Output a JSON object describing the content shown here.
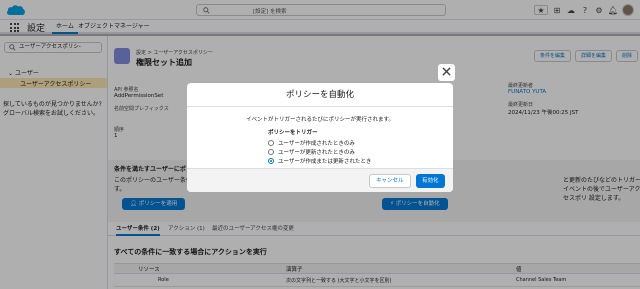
{
  "header": {
    "search_placeholder": "[設定] を検索",
    "icons": [
      "favorites-star-icon",
      "add-icon",
      "trailhead-icon",
      "help-icon",
      "setup-gear-icon",
      "notifications-bell-icon",
      "avatar"
    ]
  },
  "app_nav": {
    "app_name": "設定",
    "tabs": [
      "ホーム",
      "オブジェクトマネージャー"
    ]
  },
  "sidebar": {
    "quick_find_value": "ユーザーアクセスポリシ-",
    "section": "ユーザー",
    "active_item": "ユーザーアクセスポリシー",
    "help_text": "探しているものが見つかりませんか? グローバル検索をお試しください。"
  },
  "page": {
    "breadcrumb": "設定 > ユーザーアクセスポリシー",
    "title": "権限セット追加",
    "buttons": [
      "条件を編集",
      "詳細を編集",
      "削除"
    ],
    "details_left": [
      {
        "label": "API 参照名",
        "value": "AddPermissionSet"
      },
      {
        "label": "名前空間プレフィックス",
        "value": ""
      },
      {
        "label": "順序",
        "value": "1"
      }
    ],
    "details_right": [
      {
        "label": "最終更新者",
        "value": "FUNATO YUTA"
      },
      {
        "label": "最終更新日",
        "value": "2024/11/23 午後00:25 JST"
      }
    ],
    "conditions": {
      "title": "条件を満たすユーザーにポリシ",
      "text_left": "このポリシーのユーザー条件 リシーを手動で適用します。",
      "text_right": "と更新のたびなどのトリガーイベントの後でユーザーアクセスポリ 設定します。",
      "apply_button": "ポリシーを適用",
      "auto_button": "ポリシーを自動化"
    },
    "tabs": [
      "ユーザー条件 (2)",
      "アクション (1)",
      "最近のユーザーアクセス権の変更"
    ],
    "section_title": "すべての条件に一致する場合にアクションを実行",
    "table": {
      "headers": [
        "リソース",
        "演算子",
        "値"
      ],
      "rows": [
        [
          "Role",
          "次の文字列と一致する (大文字と小文字を区別)",
          "Channel Sales Team"
        ]
      ]
    }
  },
  "modal": {
    "title": "ポリシーを自動化",
    "description": "イベントがトリガーされるたびにポリシーが実行されます。",
    "trigger_label": "ポリシーをトリガー",
    "options": [
      "ユーザーが作成されたときのみ",
      "ユーザーが更新されたときのみ",
      "ユーザーが作成または更新されたとき"
    ],
    "selected_option": 2,
    "cancel_label": "キャンセル",
    "enable_label": "有効化"
  },
  "colors": {
    "brand": "#0176d3",
    "active_tree_item": "#fae7b1",
    "page_icon": "#7f8de1"
  }
}
